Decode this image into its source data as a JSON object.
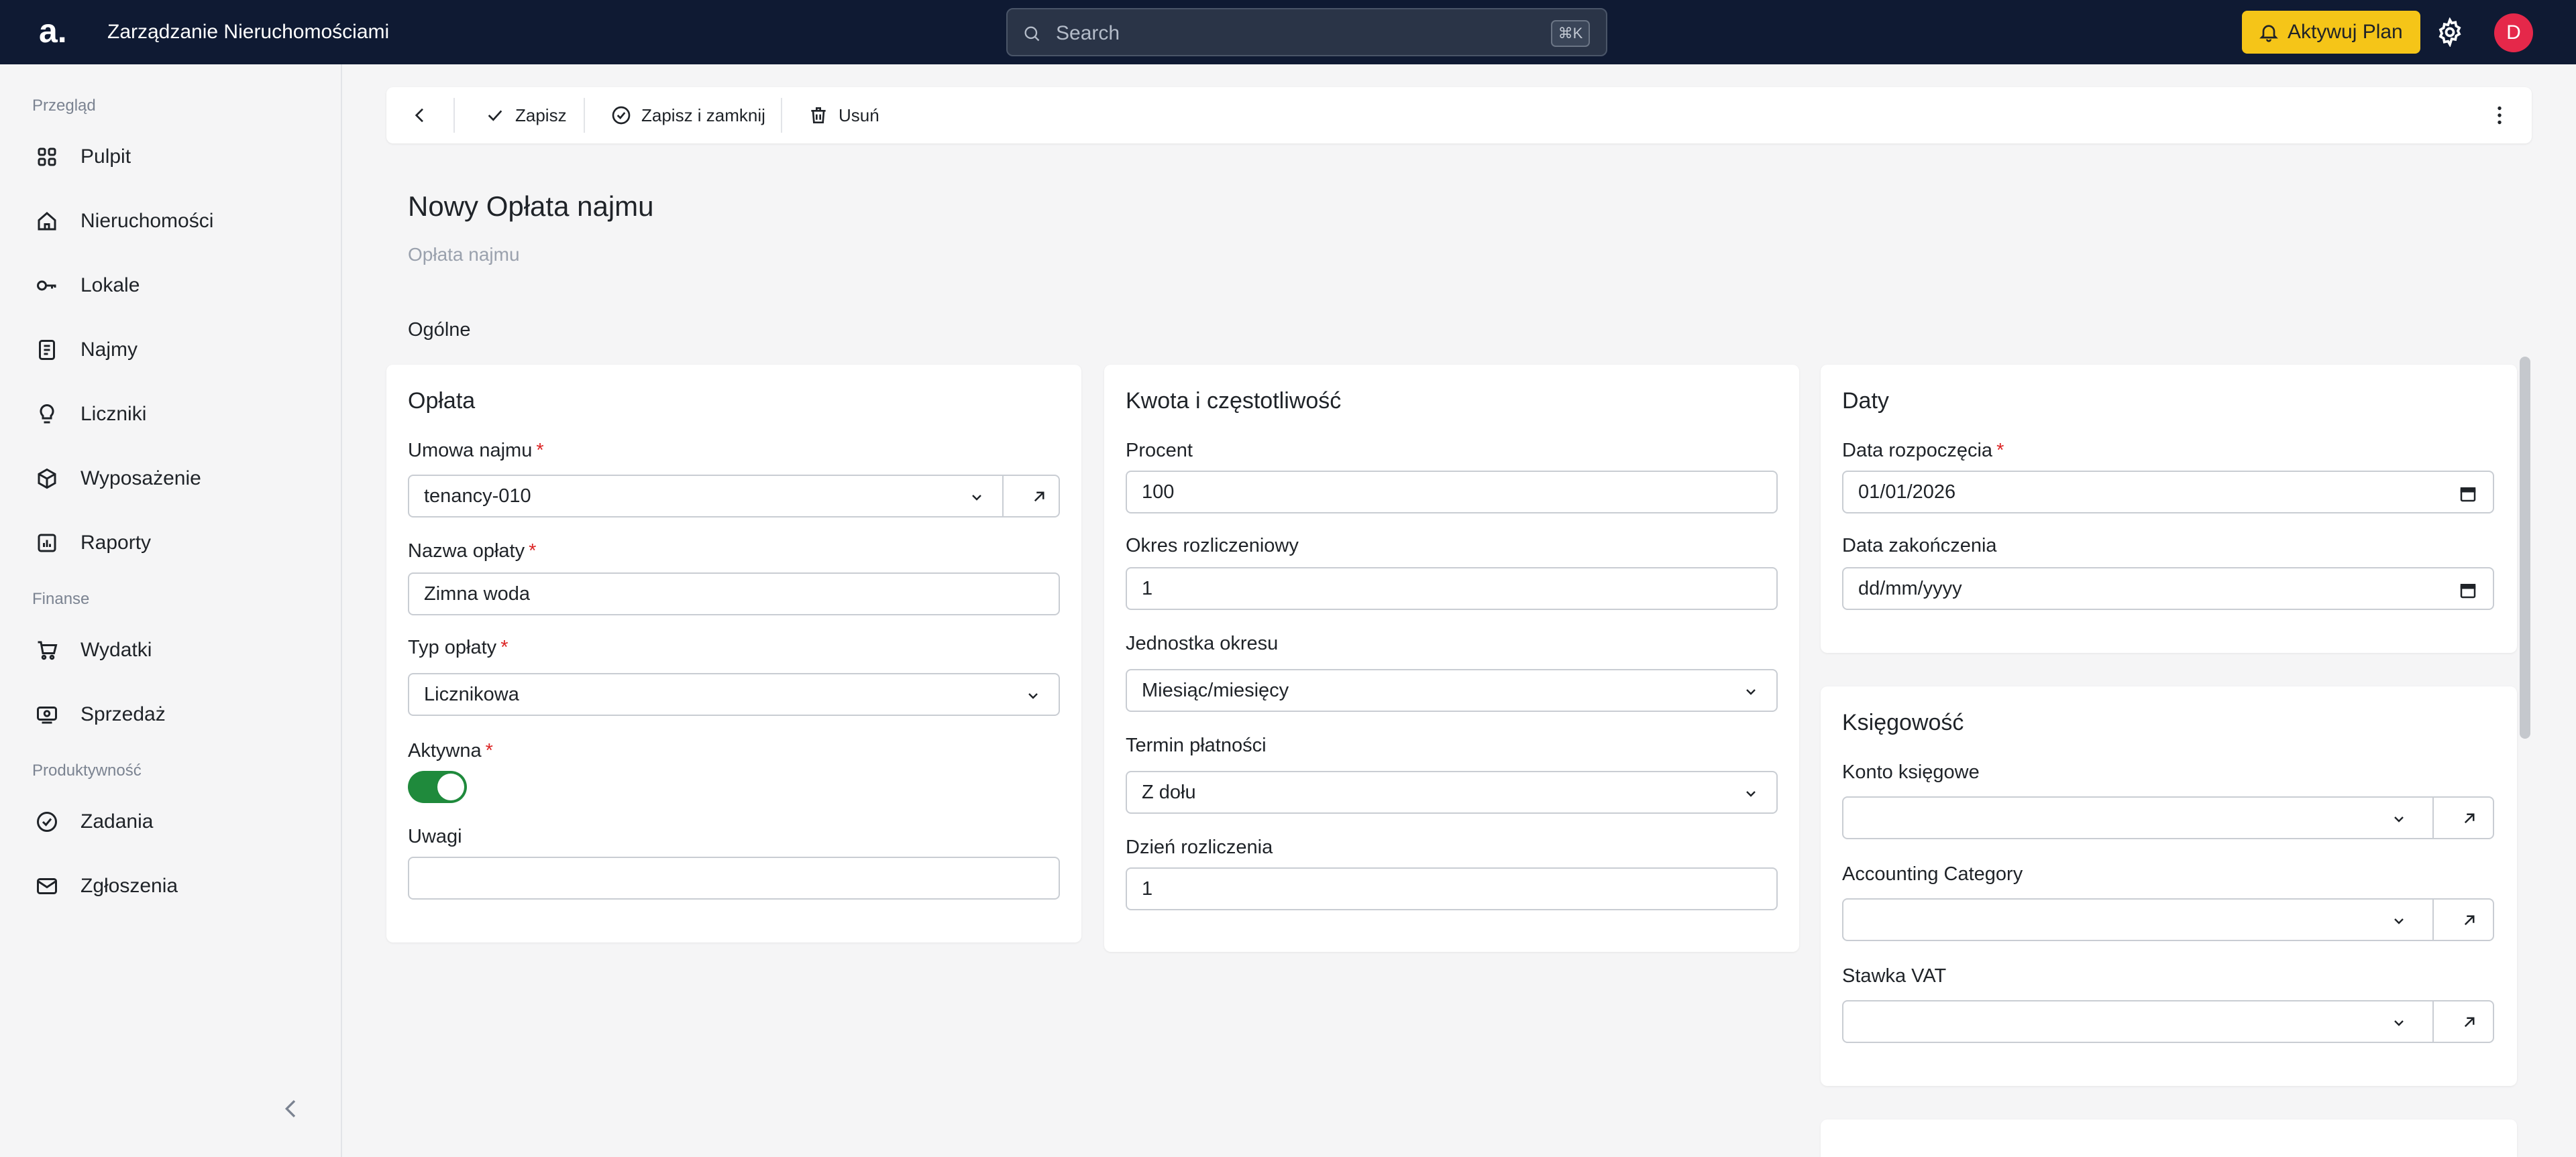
{
  "header": {
    "logo": "a.",
    "app_title": "Zarządzanie Nieruchomościami",
    "search_placeholder": "Search",
    "search_shortcut": "⌘K",
    "upgrade_label": "Aktywuj Plan",
    "avatar_initial": "D",
    "colors": {
      "bar": "#0f1a33",
      "upgrade": "#f5c518",
      "avatar": "#e5284a"
    }
  },
  "sidebar": {
    "sections": [
      "Przegląd",
      "Finanse",
      "Produktywność"
    ],
    "items": [
      {
        "label": "Pulpit",
        "icon": "grid-icon"
      },
      {
        "label": "Nieruchomości",
        "icon": "house-icon"
      },
      {
        "label": "Lokale",
        "icon": "key-icon"
      },
      {
        "label": "Najmy",
        "icon": "document-icon"
      },
      {
        "label": "Liczniki",
        "icon": "bulb-icon"
      },
      {
        "label": "Wyposażenie",
        "icon": "box-icon"
      },
      {
        "label": "Raporty",
        "icon": "report-icon"
      },
      {
        "label": "Wydatki",
        "icon": "cart-icon"
      },
      {
        "label": "Sprzedaż",
        "icon": "cash-icon"
      },
      {
        "label": "Zadania",
        "icon": "check-circle-icon"
      },
      {
        "label": "Zgłoszenia",
        "icon": "mail-icon"
      }
    ]
  },
  "toolbar": {
    "save_label": "Zapisz",
    "save_close_label": "Zapisz i zamknij",
    "delete_label": "Usuń"
  },
  "page": {
    "title": "Nowy Opłata najmu",
    "subtitle": "Opłata najmu",
    "section": "Ogólne"
  },
  "cards": {
    "fee": {
      "title": "Opłata",
      "tenancy_label": "Umowa najmu",
      "tenancy_value": "tenancy-010",
      "name_label": "Nazwa opłaty",
      "name_value": "Zimna woda",
      "type_label": "Typ opłaty",
      "type_value": "Licznikowa",
      "active_label": "Aktywna",
      "active_value": true,
      "notes_label": "Uwagi",
      "notes_value": ""
    },
    "amount": {
      "title": "Kwota i częstotliwość",
      "percent_label": "Procent",
      "percent_value": "100",
      "period_label": "Okres rozliczeniowy",
      "period_value": "1",
      "unit_label": "Jednostka okresu",
      "unit_value": "Miesiąc/miesięcy",
      "due_label": "Termin płatności",
      "due_value": "Z dołu",
      "day_label": "Dzień rozliczenia",
      "day_value": "1"
    },
    "dates": {
      "title": "Daty",
      "start_label": "Data rozpoczęcia",
      "start_value": "01/01/2026",
      "end_label": "Data zakończenia",
      "end_value": "dd/mm/yyyy"
    },
    "accounting": {
      "title": "Księgowość",
      "account_label": "Konto księgowe",
      "account_value": "",
      "category_label": "Accounting Category",
      "category_value": "",
      "vat_label": "Stawka VAT",
      "vat_value": ""
    }
  },
  "required_mark": "*"
}
